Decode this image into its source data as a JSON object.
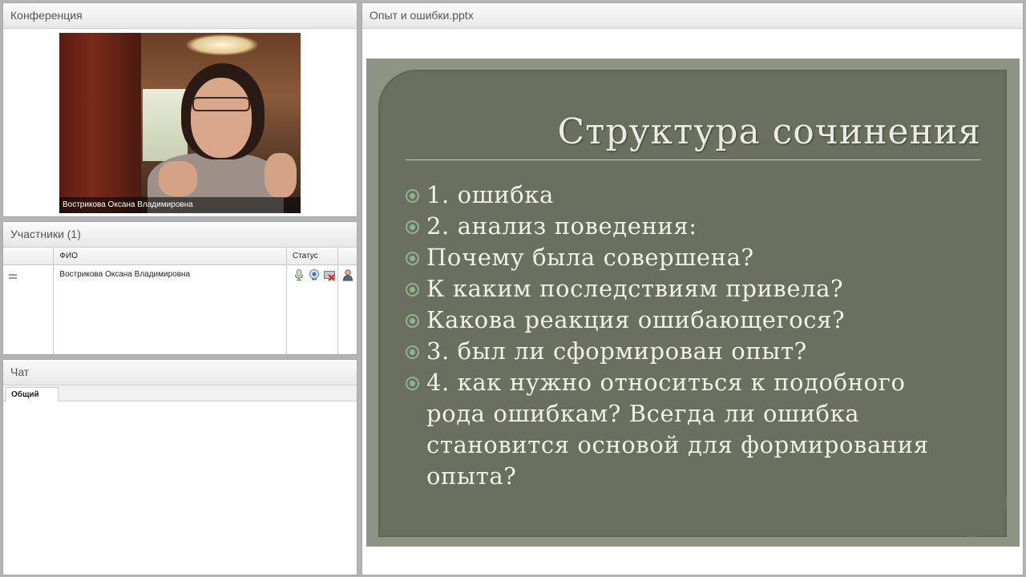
{
  "conference": {
    "title": "Конференция",
    "video_caption": "Вострикова Оксана Владимировна"
  },
  "participants": {
    "title": "Участники (1)",
    "columns": [
      "",
      "ФИО",
      "Статус",
      ""
    ],
    "rows": [
      {
        "name": "Вострикова Оксана Владимировна",
        "status_icons": [
          "microphone-icon",
          "webcam-icon",
          "camera-off-icon"
        ],
        "role_icon": "user-icon"
      }
    ]
  },
  "chat": {
    "title": "Чат",
    "tabs": [
      "Общий"
    ]
  },
  "presentation": {
    "title": "Опыт и ошибки.pptx",
    "slide": {
      "heading": "Структура сочинения",
      "bullets": [
        "1. ошибка",
        "2. анализ поведения:",
        "Почему была совершена?",
        "К каким последствиям привела?",
        "Какова реакция ошибающегося?",
        "3. был ли сформирован опыт?",
        "4. как нужно относиться к подобного рода ошибкам? Всегда ли ошибка становится основой для формирования опыта?"
      ]
    }
  }
}
